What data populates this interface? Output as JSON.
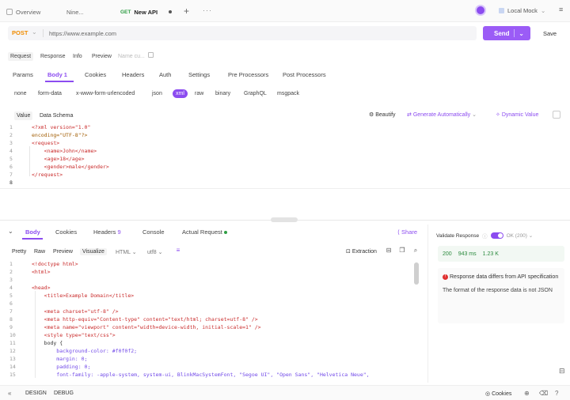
{
  "tabs": [
    {
      "label": "Overview"
    },
    {
      "label": "Nine..."
    },
    {
      "method": "GET",
      "label": "New API"
    }
  ],
  "environment": "Local Mock",
  "request": {
    "method": "POST",
    "url": "https://www.example.com",
    "send_label": "Send",
    "save_label": "Save"
  },
  "subtabs": [
    "Request",
    "Response",
    "Info",
    "Preview",
    "Name cu..."
  ],
  "request_tabs": [
    {
      "label": "Params"
    },
    {
      "label": "Body",
      "count": "1"
    },
    {
      "label": "Cookies"
    },
    {
      "label": "Headers"
    },
    {
      "label": "Auth"
    },
    {
      "label": "Settings"
    },
    {
      "label": "Pre Processors"
    },
    {
      "label": "Post Processors"
    }
  ],
  "body_types": [
    "none",
    "form-data",
    "x-www-form-urlencoded",
    "json",
    "xml",
    "raw",
    "binary",
    "GraphQL",
    "msgpack"
  ],
  "body_type_selected": "xml",
  "editor_tabs": [
    "Value",
    "Data Schema"
  ],
  "editor_tools": [
    "Beautify",
    "Generate Automatically",
    "Dynamic Value"
  ],
  "request_code": [
    "<?xml version=\"1.0\"",
    "encoding=\"UTF-8\"?>",
    "<request>",
    "    <name>John</name>",
    "    <age>18</age>",
    "    <gender>male</gender>",
    "</request>",
    ""
  ],
  "response_tabs": [
    {
      "label": "Body"
    },
    {
      "label": "Cookies"
    },
    {
      "label": "Headers",
      "count": "9"
    },
    {
      "label": "Console"
    },
    {
      "label": "Actual Request"
    }
  ],
  "share_label": "Share",
  "format_options": [
    "Pretty",
    "Raw",
    "Preview",
    "Visualize",
    "HTML",
    "utf8"
  ],
  "extraction_label": "Extraction",
  "response_code": [
    "<!doctype html>",
    "<html>",
    "",
    "<head>",
    "    <title>Example Domain</title>",
    "",
    "    <meta charset=\"utf-8\" />",
    "    <meta http-equiv=\"Content-type\" content=\"text/html; charset=utf-8\" />",
    "    <meta name=\"viewport\" content=\"width=device-width, initial-scale=1\" />",
    "    <style type=\"text/css\">",
    "    body {",
    "        background-color: #f0f0f2;",
    "        margin: 0;",
    "        padding: 0;",
    "        font-family: -apple-system, system-ui, BlinkMacSystemFont, \"Segoe UI\", \"Open Sans\", \"Helvetica Neue\","
  ],
  "validate": {
    "label": "Validate Response",
    "ok_label": "OK (200)"
  },
  "status": {
    "code": "200",
    "time": "943 ms",
    "size": "1.23 K"
  },
  "warning": {
    "title": "Response data differs from API specification",
    "detail": "The format of the response data is not JSON"
  },
  "bottom": {
    "design": "DESIGN",
    "debug": "DEBUG",
    "cookies": "Cookies"
  },
  "colors": {
    "accent": "#8c4cf0",
    "post": "#f08c00",
    "get": "#2f9e44",
    "error": "#e03131"
  }
}
